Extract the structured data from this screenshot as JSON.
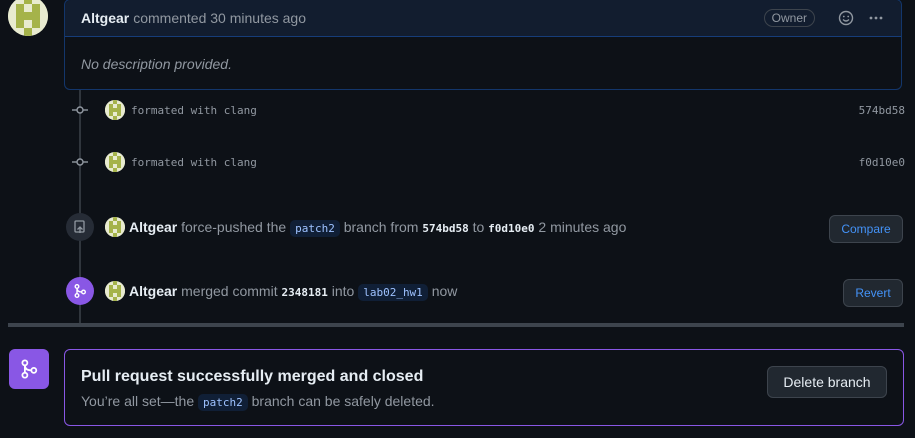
{
  "comment": {
    "author": "Altgear",
    "meta": "commented 30 minutes ago",
    "owner_badge": "Owner",
    "body": "No description provided."
  },
  "commits": [
    {
      "message": "formated with clang",
      "sha": "574bd58"
    },
    {
      "message": "formated with clang",
      "sha": "f0d10e0"
    }
  ],
  "force_push": {
    "author": "Altgear",
    "text1": "force-pushed the",
    "branch": "patch2",
    "text2": "branch from",
    "from_sha": "574bd58",
    "text3": "to",
    "to_sha": "f0d10e0",
    "time": "2 minutes ago",
    "button": "Compare"
  },
  "merge": {
    "author": "Altgear",
    "text1": "merged commit",
    "sha": "2348181",
    "text2": "into",
    "branch": "lab02_hw1",
    "time": "now",
    "button": "Revert"
  },
  "merged_status": {
    "title": "Pull request successfully merged and closed",
    "sub_prefix": "You’re all set—the",
    "branch": "patch2",
    "sub_suffix": "branch can be safely deleted.",
    "delete_button": "Delete branch"
  },
  "colors": {
    "accent_blue": "#4493f8",
    "merged_purple": "#8957e5",
    "background": "#0d1117"
  }
}
